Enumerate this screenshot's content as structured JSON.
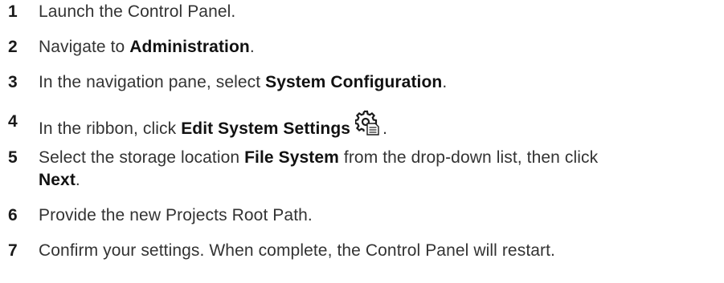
{
  "steps": [
    {
      "num": "1",
      "before": "Launch the Control Panel.",
      "bold": "",
      "after": ""
    },
    {
      "num": "2",
      "before": "Navigate to ",
      "bold": "Administration",
      "after": "."
    },
    {
      "num": "3",
      "before": "In the navigation pane, select ",
      "bold": "System Configuration",
      "after": "."
    },
    {
      "num": "4",
      "before": "In the ribbon, click ",
      "bold": "Edit System Settings",
      "after": ".",
      "icon": "settings-gear-document-icon"
    },
    {
      "num": "5",
      "before": "Select the storage location ",
      "bold": "File System",
      "after": " from the drop-down list, then click",
      "line2_bold": "Next",
      "line2_after": "."
    },
    {
      "num": "6",
      "before": "Provide the new Projects Root Path.",
      "bold": "",
      "after": ""
    },
    {
      "num": "7",
      "before": "Confirm your settings. When complete, the Control Panel will restart.",
      "bold": "",
      "after": ""
    }
  ]
}
